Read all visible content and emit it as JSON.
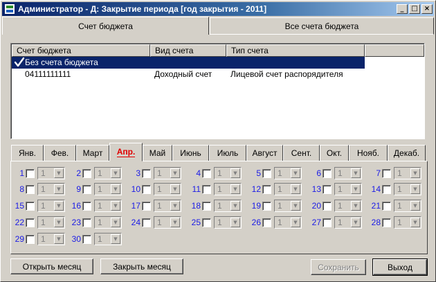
{
  "window": {
    "title": "Администратор - Д: Закрытие периода  [год закрытия - 2011]",
    "minimize": "_",
    "maximize": "□",
    "close": "×"
  },
  "top_tabs": [
    {
      "label": "Счет бюджета",
      "active": true
    },
    {
      "label": "Все счета бюджета",
      "active": false
    }
  ],
  "grid": {
    "columns": [
      "Счет бюджета",
      "Вид счета",
      "Тип счета"
    ],
    "rows": [
      {
        "account": "Без счета бюджета",
        "kind": "",
        "type": "",
        "selected": true,
        "checked": true
      },
      {
        "account": "04111111111",
        "kind": "Доходный счет",
        "type": "Лицевой счет распорядителя",
        "selected": false,
        "checked": false
      }
    ]
  },
  "months": [
    {
      "label": "Янв.",
      "active": false
    },
    {
      "label": "Фев.",
      "active": false
    },
    {
      "label": "Март",
      "active": false
    },
    {
      "label": "Апр.",
      "active": true
    },
    {
      "label": "Май",
      "active": false
    },
    {
      "label": "Июнь",
      "active": false
    },
    {
      "label": "Июль",
      "active": false
    },
    {
      "label": "Август",
      "active": false
    },
    {
      "label": "Сент.",
      "active": false
    },
    {
      "label": "Окт.",
      "active": false
    },
    {
      "label": "Нояб.",
      "active": false
    },
    {
      "label": "Декаб.",
      "active": false
    }
  ],
  "days": [
    {
      "num": "1",
      "value": "1"
    },
    {
      "num": "2",
      "value": "1"
    },
    {
      "num": "3",
      "value": "1"
    },
    {
      "num": "4",
      "value": "1"
    },
    {
      "num": "5",
      "value": "1"
    },
    {
      "num": "6",
      "value": "1"
    },
    {
      "num": "7",
      "value": "1"
    },
    {
      "num": "8",
      "value": "1"
    },
    {
      "num": "9",
      "value": "1"
    },
    {
      "num": "10",
      "value": "1"
    },
    {
      "num": "11",
      "value": "1"
    },
    {
      "num": "12",
      "value": "1"
    },
    {
      "num": "13",
      "value": "1"
    },
    {
      "num": "14",
      "value": "1"
    },
    {
      "num": "15",
      "value": "1"
    },
    {
      "num": "16",
      "value": "1"
    },
    {
      "num": "17",
      "value": "1"
    },
    {
      "num": "18",
      "value": "1"
    },
    {
      "num": "19",
      "value": "1"
    },
    {
      "num": "20",
      "value": "1"
    },
    {
      "num": "21",
      "value": "1"
    },
    {
      "num": "22",
      "value": "1"
    },
    {
      "num": "23",
      "value": "1"
    },
    {
      "num": "24",
      "value": "1"
    },
    {
      "num": "25",
      "value": "1"
    },
    {
      "num": "26",
      "value": "1"
    },
    {
      "num": "27",
      "value": "1"
    },
    {
      "num": "28",
      "value": "1"
    },
    {
      "num": "29",
      "value": "1"
    },
    {
      "num": "30",
      "value": "1"
    }
  ],
  "buttons": {
    "open_month": "Открыть месяц",
    "close_month": "Закрыть месяц",
    "save": "Сохранить",
    "exit": "Выход"
  },
  "colors": {
    "title_bar": "#0a246a",
    "selection": "#0a246a",
    "active_month": "#e00000",
    "day_number": "#1a1ae6"
  }
}
